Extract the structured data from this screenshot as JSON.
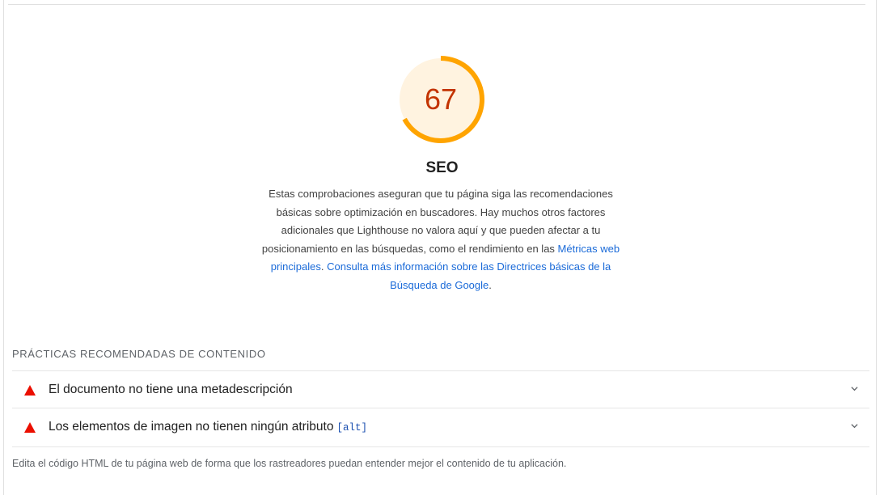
{
  "category": {
    "score": "67",
    "score_fraction": 0.67,
    "score_color": "#c33300",
    "ring_color": "#ffa400",
    "ring_fill": "#fff3e0",
    "title": "SEO",
    "description_text": "Estas comprobaciones aseguran que tu página siga las recomendaciones básicas sobre optimización en buscadores. Hay muchos otros factores adicionales que Lighthouse no valora aquí y que pueden afectar a tu posicionamiento en las búsquedas, como el rendimiento en las ",
    "link_cwv": "Métricas web principales",
    "description_mid": ". ",
    "link_guidelines": "Consulta más información sobre las Directrices básicas de la Búsqueda de Google",
    "description_end": "."
  },
  "group": {
    "title": "PRÁCTICAS RECOMENDADAS DE CONTENIDO",
    "audits": [
      {
        "status": "fail",
        "icon": "warning-triangle-icon",
        "title": "El documento no tiene una metadescripción",
        "code": ""
      },
      {
        "status": "fail",
        "icon": "warning-triangle-icon",
        "title": "Los elementos de imagen no tienen ningún atributo",
        "code": "[alt]"
      }
    ],
    "description": "Edita el código HTML de tu página web de forma que los rastreadores puedan entender mejor el contenido de tu aplicación."
  },
  "colors": {
    "fail_red": "#eb0f00",
    "link_blue": "#1a6ad8"
  }
}
